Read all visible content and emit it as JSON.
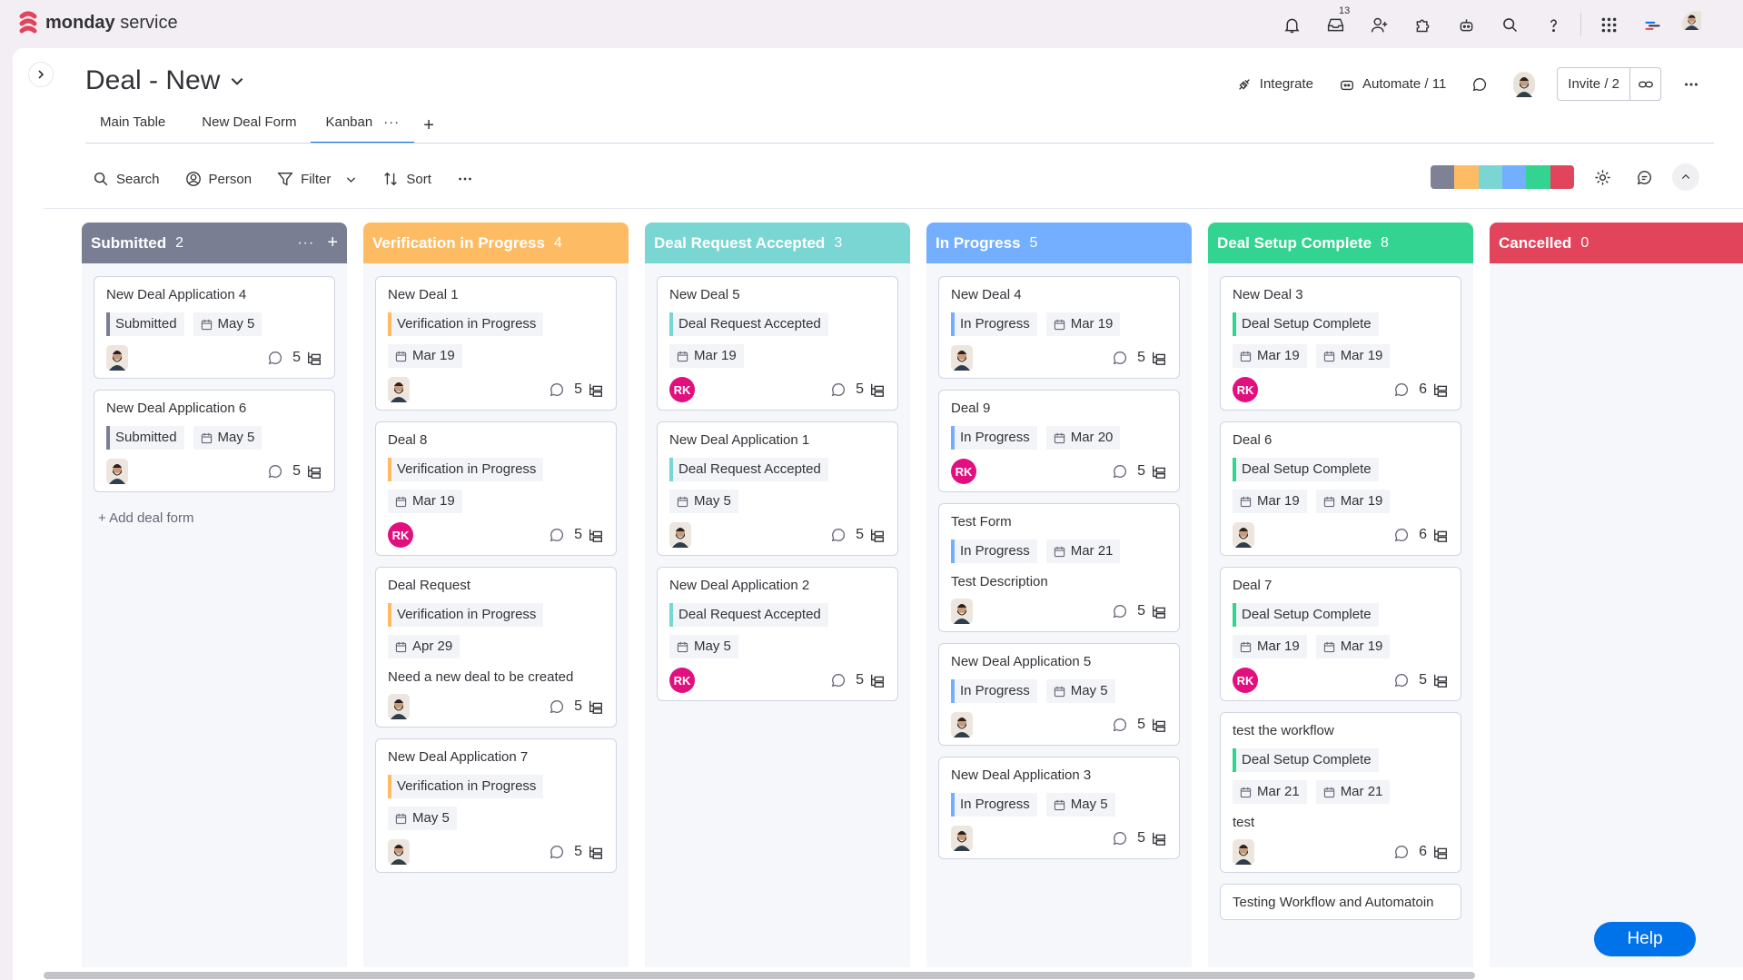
{
  "app": {
    "brand_bold": "monday",
    "brand_light": " service",
    "inbox_count": "13"
  },
  "board": {
    "title": "Deal - New"
  },
  "tabs": [
    {
      "label": "Main Table"
    },
    {
      "label": "New Deal Form"
    },
    {
      "label": "Kanban",
      "active": true
    }
  ],
  "tab_more": "···",
  "tab_add": "+",
  "header": {
    "integrate": "Integrate",
    "automate": "Automate / 11",
    "invite": "Invite / 2"
  },
  "toolbar": {
    "search": "Search",
    "person": "Person",
    "filter": "Filter",
    "sort": "Sort"
  },
  "colorbar": [
    "#7e8294",
    "#fdbc64",
    "#79d6d2",
    "#74afff",
    "#33d391",
    "#e2445c"
  ],
  "add_form": "+ Add deal form",
  "help": "Help",
  "columns": [
    {
      "title": "Submitted",
      "count": "2",
      "color": "#797e93",
      "cards": [
        {
          "name": "New Deal Application 4",
          "status": "Submitted",
          "dates": [
            "May 5"
          ],
          "desc": "",
          "avatar": "photo",
          "subitems": "5"
        },
        {
          "name": "New Deal Application 6",
          "status": "Submitted",
          "dates": [
            "May 5"
          ],
          "desc": "",
          "avatar": "photo",
          "subitems": "5"
        }
      ]
    },
    {
      "title": "Verification in Progress",
      "count": "4",
      "color": "#fdbc64",
      "cards": [
        {
          "name": "New Deal 1",
          "status": "Verification in Progress",
          "dates": [
            "Mar 19"
          ],
          "desc": "",
          "avatar": "photo",
          "subitems": "5"
        },
        {
          "name": "Deal 8",
          "status": "Verification in Progress",
          "dates": [
            "Mar 19"
          ],
          "desc": "",
          "avatar": "RK",
          "subitems": "5"
        },
        {
          "name": "Deal Request",
          "status": "Verification in Progress",
          "dates": [
            "Apr 29"
          ],
          "desc": "Need a new deal to be created",
          "avatar": "photo",
          "subitems": "5"
        },
        {
          "name": "New Deal Application 7",
          "status": "Verification in Progress",
          "dates": [
            "May 5"
          ],
          "desc": "",
          "avatar": "photo",
          "subitems": "5"
        }
      ]
    },
    {
      "title": "Deal Request Accepted",
      "count": "3",
      "color": "#79d6d2",
      "cards": [
        {
          "name": "New Deal 5",
          "status": "Deal Request Accepted",
          "dates": [
            "Mar 19"
          ],
          "desc": "",
          "avatar": "RK",
          "subitems": "5"
        },
        {
          "name": "New Deal Application 1",
          "status": "Deal Request Accepted",
          "dates": [
            "May 5"
          ],
          "desc": "",
          "avatar": "photo",
          "subitems": "5"
        },
        {
          "name": "New Deal Application 2",
          "status": "Deal Request Accepted",
          "dates": [
            "May 5"
          ],
          "desc": "",
          "avatar": "RK",
          "subitems": "5"
        }
      ]
    },
    {
      "title": "In Progress",
      "count": "5",
      "color": "#74afff",
      "cards": [
        {
          "name": "New Deal 4",
          "status": "In Progress",
          "dates": [
            "Mar 19"
          ],
          "desc": "",
          "avatar": "photo",
          "subitems": "5"
        },
        {
          "name": "Deal 9",
          "status": "In Progress",
          "dates": [
            "Mar 20"
          ],
          "desc": "",
          "avatar": "RK",
          "subitems": "5"
        },
        {
          "name": "Test Form",
          "status": "In Progress",
          "dates": [
            "Mar 21"
          ],
          "desc": "Test Description",
          "avatar": "photo",
          "subitems": "5"
        },
        {
          "name": "New Deal Application 5",
          "status": "In Progress",
          "dates": [
            "May 5"
          ],
          "desc": "",
          "avatar": "photo",
          "subitems": "5"
        },
        {
          "name": "New Deal Application 3",
          "status": "In Progress",
          "dates": [
            "May 5"
          ],
          "desc": "",
          "avatar": "photo",
          "subitems": "5"
        }
      ]
    },
    {
      "title": "Deal Setup Complete",
      "count": "8",
      "color": "#33d391",
      "cards": [
        {
          "name": "New Deal 3",
          "status": "Deal Setup Complete",
          "dates": [
            "Mar 19",
            "Mar 19"
          ],
          "desc": "",
          "avatar": "RK",
          "subitems": "6"
        },
        {
          "name": "Deal 6",
          "status": "Deal Setup Complete",
          "dates": [
            "Mar 19",
            "Mar 19"
          ],
          "desc": "",
          "avatar": "photo",
          "subitems": "6"
        },
        {
          "name": "Deal 7",
          "status": "Deal Setup Complete",
          "dates": [
            "Mar 19",
            "Mar 19"
          ],
          "desc": "",
          "avatar": "RK",
          "subitems": "5"
        },
        {
          "name": "test the workflow",
          "status": "Deal Setup Complete",
          "dates": [
            "Mar 21",
            "Mar 21"
          ],
          "desc": "test",
          "avatar": "photo",
          "subitems": "6"
        },
        {
          "name": "Testing Workflow and Automatoin",
          "status": "",
          "dates": [],
          "desc": "",
          "avatar": "",
          "subitems": ""
        }
      ]
    },
    {
      "title": "Cancelled",
      "count": "0",
      "color": "#e2445c",
      "cards": []
    }
  ]
}
